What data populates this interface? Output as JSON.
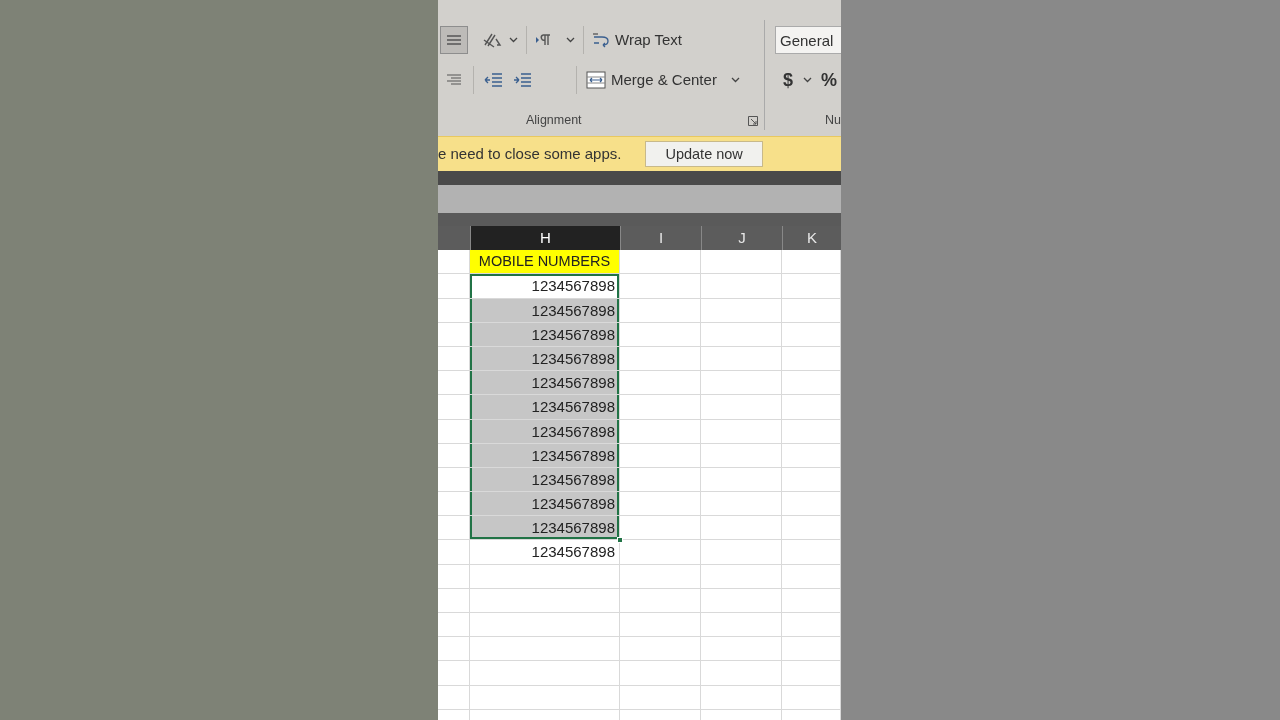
{
  "ribbon": {
    "align_middle_selected": true,
    "wrap_text": "Wrap Text",
    "merge": "Merge & Center",
    "alignment_label": "Alignment",
    "number_format": "General",
    "currency": "$",
    "percent": "%",
    "number_label": "Nu"
  },
  "notification": {
    "message": "e need to close some apps.",
    "button": "Update now"
  },
  "columns": [
    {
      "label": "H",
      "selected": true
    },
    {
      "label": "I",
      "selected": false
    },
    {
      "label": "J",
      "selected": false
    },
    {
      "label": "K",
      "selected": false
    }
  ],
  "rows": [
    {
      "kind": "header",
      "value": "MOBILE NUMBERS",
      "selected": false
    },
    {
      "kind": "number",
      "value": "1234567898",
      "selected": true
    },
    {
      "kind": "number",
      "value": "1234567898",
      "selected": true
    },
    {
      "kind": "number",
      "value": "1234567898",
      "selected": true
    },
    {
      "kind": "number",
      "value": "1234567898",
      "selected": true
    },
    {
      "kind": "number",
      "value": "1234567898",
      "selected": true
    },
    {
      "kind": "number",
      "value": "1234567898",
      "selected": true
    },
    {
      "kind": "number",
      "value": "1234567898",
      "selected": true
    },
    {
      "kind": "number",
      "value": "1234567898",
      "selected": true
    },
    {
      "kind": "number",
      "value": "1234567898",
      "selected": true
    },
    {
      "kind": "number",
      "value": "1234567898",
      "selected": true
    },
    {
      "kind": "number",
      "value": "1234567898",
      "selected": true
    },
    {
      "kind": "number",
      "value": "1234567898",
      "selected": false
    }
  ]
}
